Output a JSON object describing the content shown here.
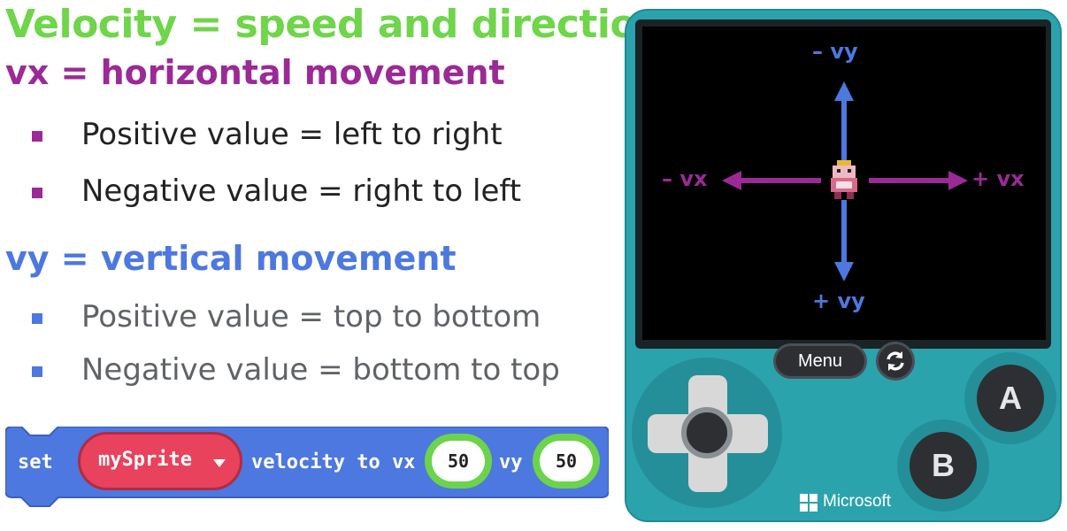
{
  "title": "Velocity = speed and direction",
  "vx_heading": "vx = horizontal movement",
  "vx_bullets": [
    "Positive value = left to right",
    "Negative value = right to left"
  ],
  "vy_heading": "vy = vertical movement",
  "vy_bullets": [
    "Positive value = top to bottom",
    "Negative value = bottom to top"
  ],
  "block": {
    "set_label": "set",
    "sprite_name": "mySprite",
    "velocity_label": "velocity to vx",
    "vx_value": "50",
    "vy_label": "vy",
    "vy_value": "50"
  },
  "console": {
    "labels": {
      "neg_vy": "– vy",
      "pos_vy": "+ vy",
      "neg_vx": "– vx",
      "pos_vx": "+ vx"
    },
    "menu_label": "Menu",
    "a_label": "A",
    "b_label": "B",
    "brand": "Microsoft"
  },
  "colors": {
    "title": "#6fd54a",
    "vx": "#9b2a96",
    "vy": "#4c78e0",
    "block": "#4c78e0",
    "sprite": "#e8425c",
    "console": "#2ba3ad"
  },
  "icons": [
    "square-bullet-icon",
    "arrow-up-icon",
    "arrow-down-icon",
    "arrow-left-icon",
    "arrow-right-icon",
    "refresh-icon",
    "dropdown-caret-icon",
    "microsoft-logo-icon",
    "sprite-character-icon"
  ]
}
